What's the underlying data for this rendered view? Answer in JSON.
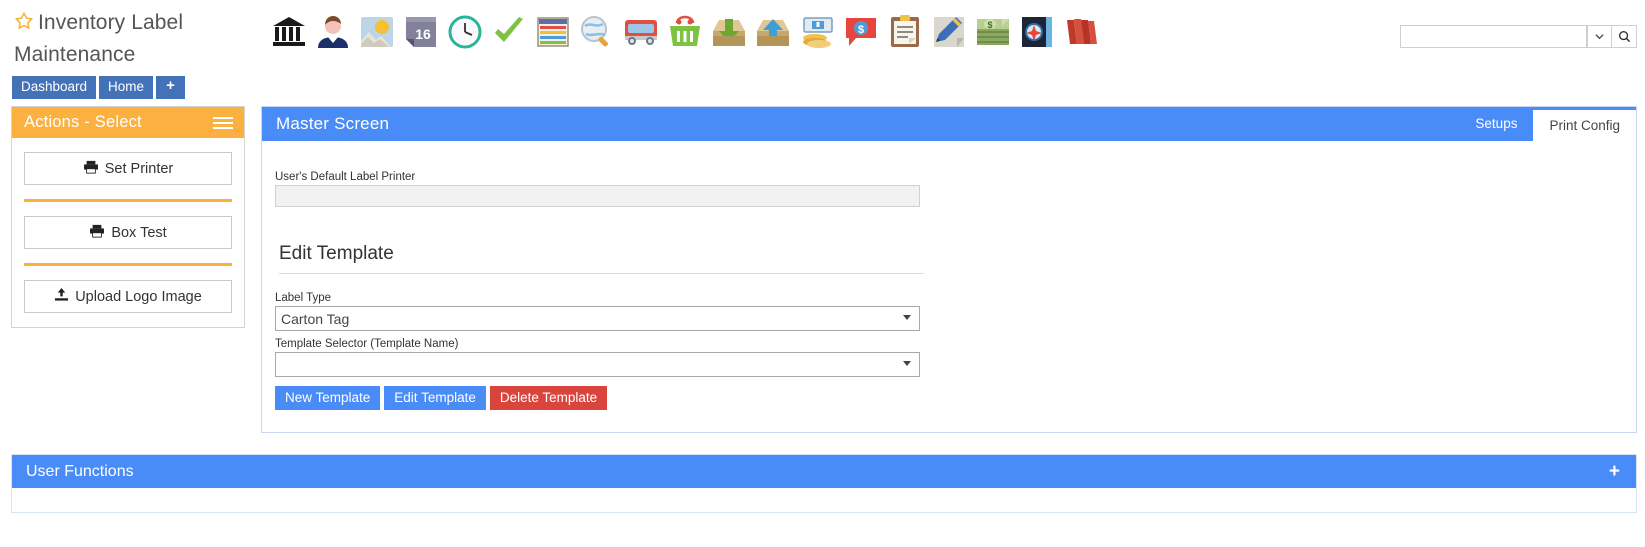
{
  "app": {
    "title": "Inventory Label Maintenance",
    "star_icon": "star-icon"
  },
  "toolbar": {
    "icons": [
      {
        "name": "bank-icon",
        "label": "Bank"
      },
      {
        "name": "user-icon",
        "label": "User"
      },
      {
        "name": "image-icon",
        "label": "Image"
      },
      {
        "name": "calendar-16-icon",
        "label": "16"
      },
      {
        "name": "clock-icon",
        "label": "Clock"
      },
      {
        "name": "checkmark-icon",
        "label": "Check"
      },
      {
        "name": "spreadsheet-icon",
        "label": "Spreadsheet"
      },
      {
        "name": "search-globe-icon",
        "label": "Search"
      },
      {
        "name": "truck-icon",
        "label": "Truck"
      },
      {
        "name": "shopping-basket-icon",
        "label": "Basket"
      },
      {
        "name": "inbox-download-icon",
        "label": "Receive"
      },
      {
        "name": "outbox-upload-icon",
        "label": "Ship"
      },
      {
        "name": "cash-payment-icon",
        "label": "Payment"
      },
      {
        "name": "price-tag-dollar-icon",
        "label": "Price"
      },
      {
        "name": "clipboard-icon",
        "label": "Clipboard"
      },
      {
        "name": "pencil-edit-icon",
        "label": "Edit"
      },
      {
        "name": "money-icon",
        "label": "Money"
      },
      {
        "name": "compass-book-icon",
        "label": "Reference"
      },
      {
        "name": "red-books-icon",
        "label": "Books"
      }
    ]
  },
  "search": {
    "value": "",
    "placeholder": "",
    "dropdown_icon": "chevron-down-icon",
    "button_icon": "search-icon"
  },
  "nav": {
    "tabs": [
      {
        "label": "Dashboard",
        "name": "nav-tab-dashboard"
      },
      {
        "label": "Home",
        "name": "nav-tab-home"
      }
    ],
    "add_label": "+"
  },
  "actions_panel": {
    "title": "Actions - Select",
    "menu_icon": "hamburger-icon",
    "buttons": [
      {
        "label": "Set Printer",
        "icon": "printer-icon",
        "name": "set-printer-button"
      },
      {
        "label": "Box Test",
        "icon": "printer-icon",
        "name": "box-test-button"
      },
      {
        "label": "Upload Logo Image",
        "icon": "upload-icon",
        "name": "upload-logo-image-button"
      }
    ]
  },
  "master": {
    "title": "Master Screen",
    "tabs": [
      {
        "label": "Setups",
        "active": false,
        "name": "tab-setups"
      },
      {
        "label": "Print Config",
        "active": true,
        "name": "tab-print-config"
      }
    ],
    "default_printer": {
      "label": "User's Default Label Printer",
      "value": "",
      "placeholder": ""
    },
    "edit_template": {
      "heading": "Edit Template",
      "label_type": {
        "label": "Label Type",
        "value": "Carton Tag",
        "options": [
          "Carton Tag"
        ]
      },
      "template_selector": {
        "label": "Template Selector (Template Name)",
        "value": "",
        "options": [
          ""
        ]
      },
      "buttons": [
        {
          "label": "New Template",
          "style": "blue",
          "name": "new-template-button"
        },
        {
          "label": "Edit Template",
          "style": "blue",
          "name": "edit-template-button"
        },
        {
          "label": "Delete Template",
          "style": "red",
          "name": "delete-template-button"
        }
      ]
    }
  },
  "user_functions": {
    "title": "User Functions",
    "add_label": "+"
  },
  "colors": {
    "accent_blue": "#4a8cf7",
    "nav_blue": "#4372b8",
    "accent_orange": "#fcb040",
    "danger_red": "#d9443c",
    "star_gold": "#f5b335"
  }
}
